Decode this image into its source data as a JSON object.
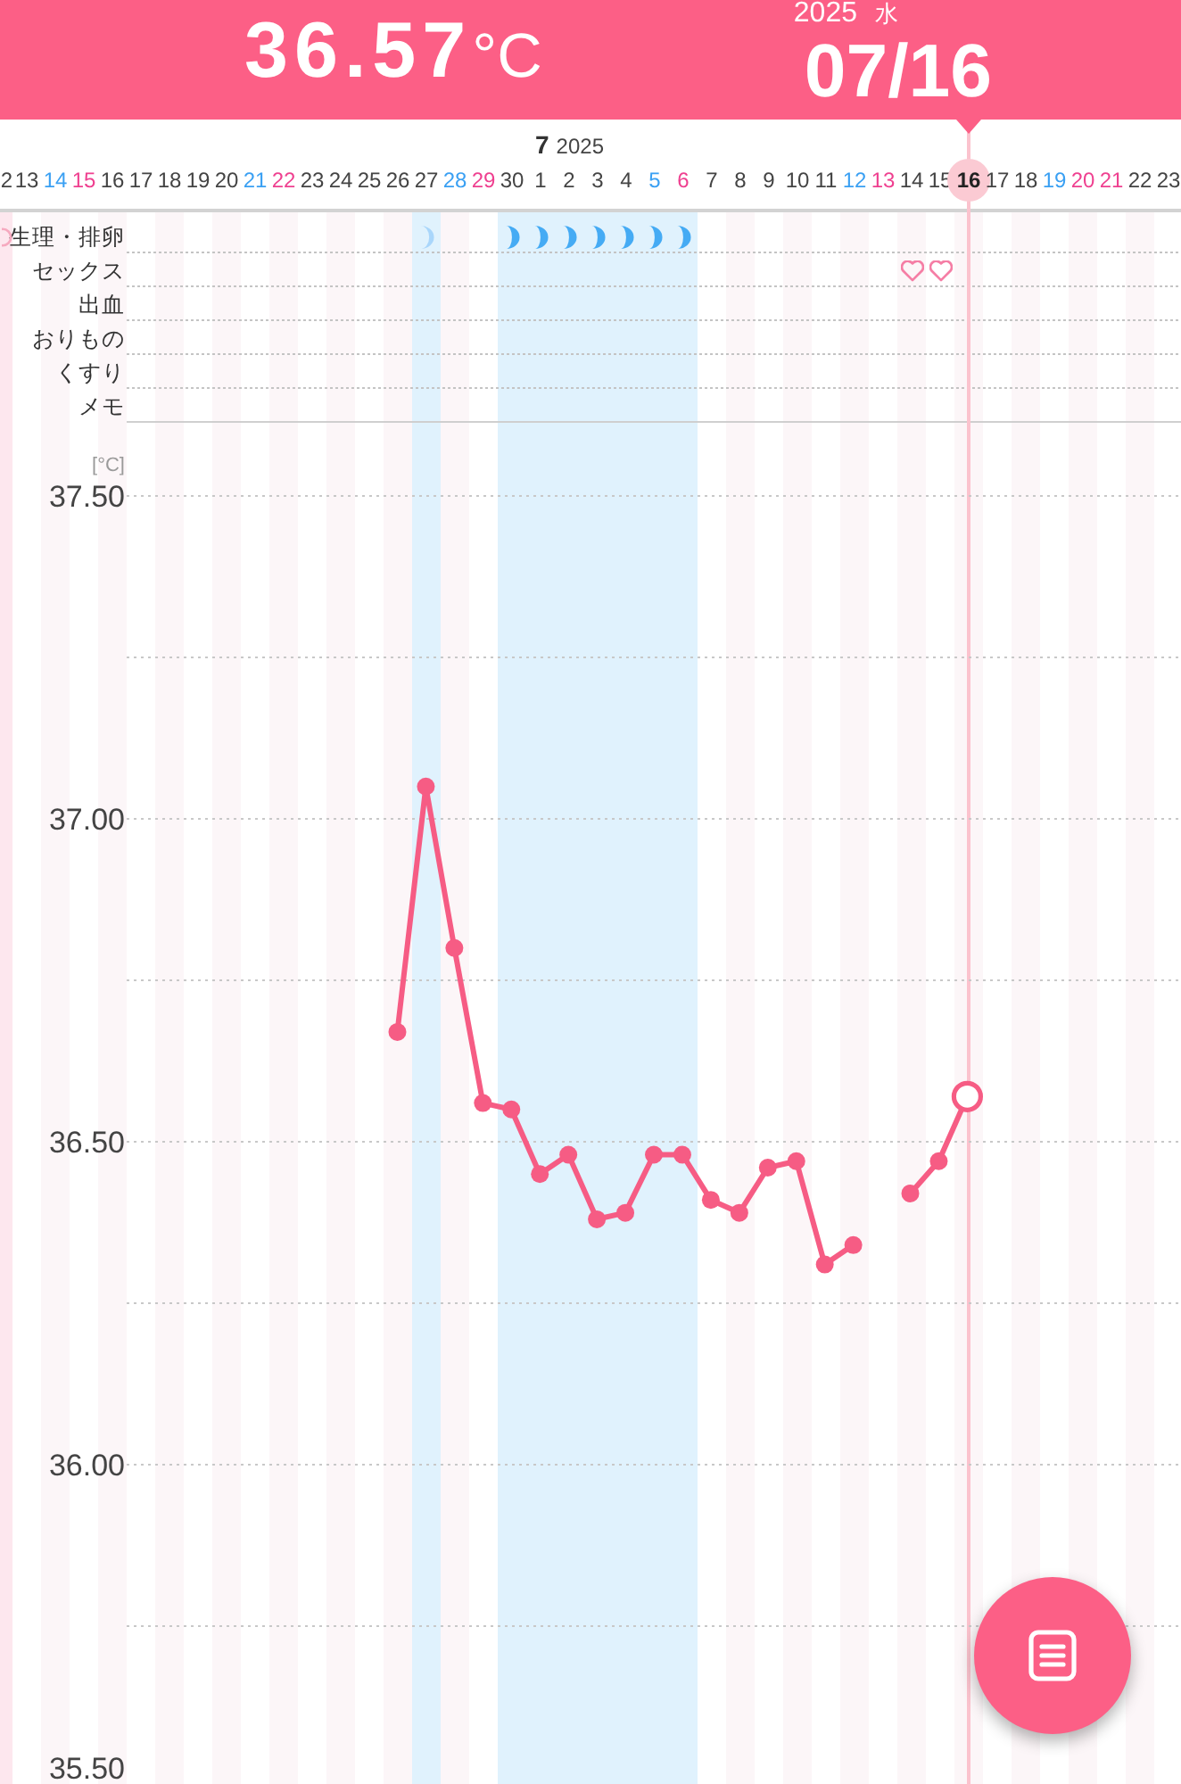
{
  "header": {
    "temperature": {
      "value": "36.57",
      "unit": "°C"
    },
    "date": {
      "year": "2025",
      "weekday": "水",
      "date": "07/16"
    }
  },
  "date_strip": {
    "month": "7",
    "year": "2025",
    "days": [
      {
        "label": "2",
        "kind": "weekday",
        "selected": false,
        "heart": false,
        "cycle_mark": {
          "kind": "ring"
        }
      },
      {
        "label": "13",
        "kind": "weekday",
        "selected": false,
        "heart": false
      },
      {
        "label": "14",
        "kind": "saturday",
        "selected": false,
        "heart": false
      },
      {
        "label": "15",
        "kind": "sunday",
        "selected": false,
        "heart": false
      },
      {
        "label": "16",
        "kind": "weekday",
        "selected": false,
        "heart": false
      },
      {
        "label": "17",
        "kind": "weekday",
        "selected": false,
        "heart": false
      },
      {
        "label": "18",
        "kind": "weekday",
        "selected": false,
        "heart": false
      },
      {
        "label": "19",
        "kind": "weekday",
        "selected": false,
        "heart": false
      },
      {
        "label": "20",
        "kind": "weekday",
        "selected": false,
        "heart": false
      },
      {
        "label": "21",
        "kind": "saturday",
        "selected": false,
        "heart": false
      },
      {
        "label": "22",
        "kind": "sunday",
        "selected": false,
        "heart": false
      },
      {
        "label": "23",
        "kind": "weekday",
        "selected": false,
        "heart": false
      },
      {
        "label": "24",
        "kind": "weekday",
        "selected": false,
        "heart": false
      },
      {
        "label": "25",
        "kind": "weekday",
        "selected": false,
        "heart": false
      },
      {
        "label": "26",
        "kind": "weekday",
        "selected": false,
        "heart": false
      },
      {
        "label": "27",
        "kind": "weekday",
        "selected": false,
        "heart": false,
        "cycle_mark": {
          "kind": "light_crescent"
        }
      },
      {
        "label": "28",
        "kind": "saturday",
        "selected": false,
        "heart": false
      },
      {
        "label": "29",
        "kind": "sunday",
        "selected": false,
        "heart": false
      },
      {
        "label": "30",
        "kind": "weekday",
        "selected": false,
        "heart": false,
        "cycle_mark": {
          "kind": "crescent"
        }
      },
      {
        "label": "1",
        "kind": "weekday",
        "selected": false,
        "heart": false,
        "cycle_mark": {
          "kind": "crescent"
        }
      },
      {
        "label": "2",
        "kind": "weekday",
        "selected": false,
        "heart": false,
        "cycle_mark": {
          "kind": "crescent"
        }
      },
      {
        "label": "3",
        "kind": "weekday",
        "selected": false,
        "heart": false,
        "cycle_mark": {
          "kind": "crescent"
        }
      },
      {
        "label": "4",
        "kind": "weekday",
        "selected": false,
        "heart": false,
        "cycle_mark": {
          "kind": "crescent"
        }
      },
      {
        "label": "5",
        "kind": "saturday",
        "selected": false,
        "heart": false,
        "cycle_mark": {
          "kind": "crescent"
        }
      },
      {
        "label": "6",
        "kind": "sunday",
        "selected": false,
        "heart": false,
        "cycle_mark": {
          "kind": "crescent"
        }
      },
      {
        "label": "7",
        "kind": "weekday",
        "selected": false,
        "heart": false
      },
      {
        "label": "8",
        "kind": "weekday",
        "selected": false,
        "heart": false
      },
      {
        "label": "9",
        "kind": "weekday",
        "selected": false,
        "heart": false
      },
      {
        "label": "10",
        "kind": "weekday",
        "selected": false,
        "heart": false
      },
      {
        "label": "11",
        "kind": "weekday",
        "selected": false,
        "heart": false
      },
      {
        "label": "12",
        "kind": "saturday",
        "selected": false,
        "heart": false
      },
      {
        "label": "13",
        "kind": "sunday",
        "selected": false,
        "heart": false
      },
      {
        "label": "14",
        "kind": "weekday",
        "selected": false,
        "heart": true
      },
      {
        "label": "15",
        "kind": "weekday",
        "selected": false,
        "heart": true
      },
      {
        "label": "16",
        "kind": "weekday",
        "selected": true,
        "heart": false
      },
      {
        "label": "17",
        "kind": "weekday",
        "selected": false,
        "heart": false
      },
      {
        "label": "18",
        "kind": "weekday",
        "selected": false,
        "heart": false
      },
      {
        "label": "19",
        "kind": "saturday",
        "selected": false,
        "heart": false
      },
      {
        "label": "20",
        "kind": "sunday",
        "selected": false,
        "heart": false
      },
      {
        "label": "21",
        "kind": "holiday",
        "selected": false,
        "heart": false
      },
      {
        "label": "22",
        "kind": "weekday",
        "selected": false,
        "heart": false
      },
      {
        "label": "23",
        "kind": "weekday",
        "selected": false,
        "heart": false
      }
    ]
  },
  "records": {
    "rows": [
      {
        "label": "生理・排卵",
        "kind": "cycle"
      },
      {
        "label": "セックス",
        "kind": "heart"
      },
      {
        "label": "出血",
        "kind": "bleeding"
      },
      {
        "label": "おりもの",
        "kind": "discharge"
      },
      {
        "label": "くすり",
        "kind": "medicine"
      },
      {
        "label": "メモ",
        "kind": "memo"
      }
    ]
  },
  "temperature_chart": {
    "chart_data": {
      "type": "line",
      "ylabel": "[°C]",
      "ylim": [
        35.5,
        37.5
      ],
      "grid": true,
      "yticks": [
        {
          "value": 37.5,
          "label": "37.50"
        },
        {
          "value": 37,
          "label": "37.00"
        },
        {
          "value": 36.5,
          "label": "36.50"
        },
        {
          "value": 36,
          "label": "36.00"
        },
        {
          "value": 35.5,
          "label": "35.50"
        }
      ],
      "series": [
        {
          "color": "#f65c84",
          "marker": true,
          "values": [
            null,
            null,
            null,
            null,
            null,
            null,
            null,
            null,
            null,
            36.67,
            37.05,
            36.8,
            36.56,
            36.55,
            36.45,
            36.48,
            36.38,
            36.39,
            36.48,
            36.48,
            36.41,
            36.39,
            36.46,
            36.47,
            36.31,
            36.34,
            null,
            36.42,
            36.47,
            36.57,
            null,
            null,
            null,
            null,
            null,
            null,
            null
          ]
        }
      ]
    }
  }
}
